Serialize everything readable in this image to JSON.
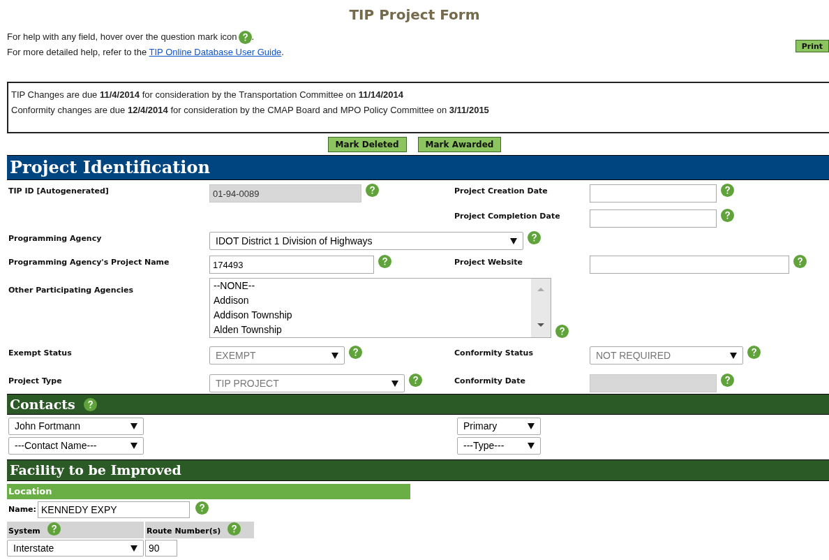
{
  "title": "TIP Project Form",
  "help": {
    "line_1": "For help with any field, hover over the question mark icon",
    "line_1_end": ".",
    "line_2": "For more detailed help, refer to the ",
    "link": "TIP Online Database User Guide",
    "line_2_end": "."
  },
  "print_button": "Print",
  "notices": [
    "TIP Changes are due **11/4/2014** for consideration by the Transportation Committee on **11/14/2014**",
    "Conformity changes are due **12/4/2014** for consideration by the CMAP Board and MPO Policy Committee on **3/11/2015**"
  ],
  "actions": [
    "Mark Deleted",
    "Mark Awarded"
  ],
  "project_identification": {
    "heading": "Project Identification",
    "rows": [
      {
        "left": {
          "label": "TIP ID [Autogenerated]",
          "field": {
            "kind": "text",
            "value": "01-94-0089",
            "disabled": true
          }
        },
        "right": {
          "label": "Project Creation Date",
          "field": {
            "kind": "text",
            "disabled": false
          }
        }
      },
      {
        "right": {
          "label": "Project Completion Date",
          "field": {
            "kind": "text",
            "disabled": false
          }
        }
      },
      {
        "left": {
          "label": "Programming Agency",
          "field": {
            "kind": "select",
            "value": "IDOT District 1 Division of Highways",
            "disabled": false
          }
        }
      },
      {
        "left": {
          "label": "Programming Agency's Project Name",
          "field": {
            "kind": "text",
            "value": "174493",
            "disabled": false
          }
        },
        "right": {
          "label": "Project Website",
          "field": {
            "kind": "text",
            "disabled": false
          }
        }
      },
      {
        "left": {
          "label": "Other Participating Agencies",
          "field": {
            "kind": "listbox",
            "options": [
              "--NONE--",
              "Addison",
              "Addison Township",
              "Alden Township"
            ],
            "disabled": false
          }
        }
      },
      {
        "left": {
          "label": "Exempt Status",
          "field": {
            "kind": "select",
            "value": "EXEMPT",
            "disabled": true
          }
        },
        "right": {
          "label": "Conformity Status",
          "field": {
            "kind": "select",
            "value": "NOT REQUIRED",
            "disabled": true
          }
        }
      },
      {
        "left": {
          "label": "Project Type",
          "field": {
            "kind": "select",
            "value": "TIP PROJECT",
            "disabled": true
          }
        },
        "right": {
          "label": "Conformity Date",
          "field": {
            "kind": "text",
            "disabled": true
          }
        }
      }
    ]
  },
  "contacts": {
    "heading": "Contacts",
    "rows": [
      {
        "name": "John Fortmann",
        "type": "Primary"
      },
      {
        "name": "---Contact Name---",
        "type": "---Type---"
      }
    ]
  },
  "facility": {
    "heading": "Facility to be Improved",
    "subheading": "Location",
    "name_label": "Name:",
    "name_value": "KENNEDY EXPY",
    "columns": [
      "System",
      "Route Number(s)"
    ],
    "system": "Interstate",
    "route": "90"
  }
}
